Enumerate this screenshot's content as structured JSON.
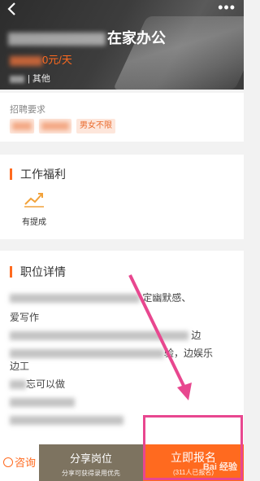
{
  "header": {
    "back_icon": "chevron-left-icon",
    "more_icon": "more-dots-icon",
    "title_visible": "在家办公",
    "salary_unit": "0元/天",
    "category": "| 其他"
  },
  "recruit": {
    "label": "招聘要求",
    "tags": [
      "男女不限"
    ]
  },
  "welfare": {
    "title": "工作福利",
    "items": [
      {
        "icon": "trending-chart-icon",
        "label": "有提成"
      }
    ]
  },
  "detail": {
    "title": "职位详情",
    "lines": [
      "定幽默感、",
      "爱写作",
      "边",
      "验，边娱乐",
      "边工",
      "忘可以做"
    ]
  },
  "bottom_bar": {
    "consult_label": "咨询",
    "share_label": "分享岗位",
    "share_hint": "分享可获得录用优先",
    "apply_label": "立即报名",
    "apply_hint": "(311人已报名)"
  },
  "watermark": "Bai 经验",
  "colors": {
    "accent": "#ff6a1f",
    "share_bg": "#7d7360",
    "annotation": "#e8478f"
  }
}
